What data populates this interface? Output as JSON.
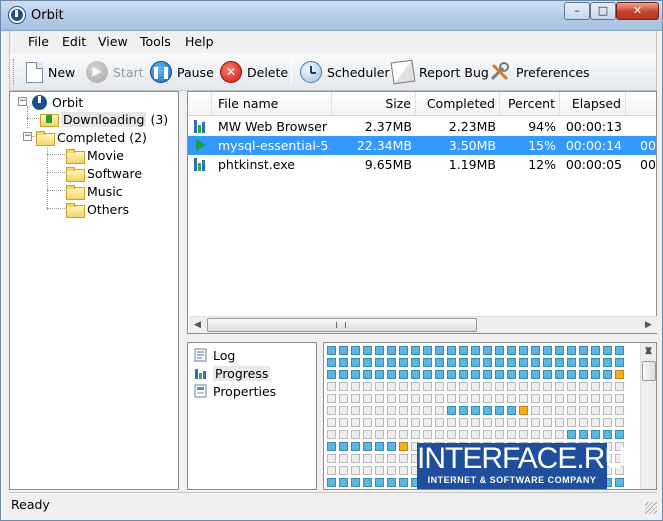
{
  "window": {
    "title": "Orbit",
    "min_label": "–",
    "max_label": "□",
    "close_label": "✕"
  },
  "menu": [
    "File",
    "Edit",
    "View",
    "Tools",
    "Help"
  ],
  "toolbar": {
    "new": "New",
    "start": "Start",
    "pause": "Pause",
    "delete": "Delete",
    "scheduler": "Scheduler",
    "report_bug": "Report Bug",
    "preferences": "Preferences"
  },
  "tree": {
    "root": "Orbit",
    "downloading": {
      "label": "Downloading",
      "count": "(3)"
    },
    "completed": {
      "label": "Completed",
      "count": "(2)"
    },
    "children": [
      "Movie",
      "Software",
      "Music",
      "Others"
    ]
  },
  "table": {
    "headers": [
      "File name",
      "Size",
      "Completed",
      "Percent",
      "Elapsed"
    ],
    "rows": [
      {
        "name": "MW Web Browser ...",
        "size": "2.37MB",
        "completed": "2.23MB",
        "percent": "94%",
        "elapsed": "00:00:13",
        "extra": "",
        "status": "downloading-icon"
      },
      {
        "name": "mysql-essential-5....",
        "size": "22.34MB",
        "completed": "3.50MB",
        "percent": "15%",
        "elapsed": "00:00:14",
        "extra": "00",
        "status": "play-icon"
      },
      {
        "name": "phtkinst.exe",
        "size": "9.65MB",
        "completed": "1.19MB",
        "percent": "12%",
        "elapsed": "00:00:05",
        "extra": "00",
        "status": "downloading-icon"
      }
    ]
  },
  "bottom_tabs": [
    "Log",
    "Progress",
    "Properties"
  ],
  "progress_grid": {
    "columns": 25,
    "rows": 12,
    "done_rows": {
      "0": [
        0,
        24
      ],
      "1": [
        0,
        24
      ]
    },
    "segments": [
      {
        "row": 0,
        "from": 0,
        "to": 24
      },
      {
        "row": 1,
        "from": 0,
        "to": 24
      },
      {
        "row": 2,
        "from": 0,
        "to": 24,
        "active": 24
      },
      {
        "row": 5,
        "from": 10,
        "to": 16,
        "active": 16
      },
      {
        "row": 7,
        "from": 20,
        "to": 24
      },
      {
        "row": 8,
        "from": 0,
        "to": 6,
        "active": 6
      },
      {
        "row": 11,
        "from": 0,
        "to": 24
      }
    ],
    "done_color": "#5fb5de",
    "active_color": "#f6ad1c"
  },
  "watermark": {
    "big": "INTERFACE.RU",
    "small": "INTERNET & SOFTWARE COMPANY"
  },
  "status": "Ready"
}
